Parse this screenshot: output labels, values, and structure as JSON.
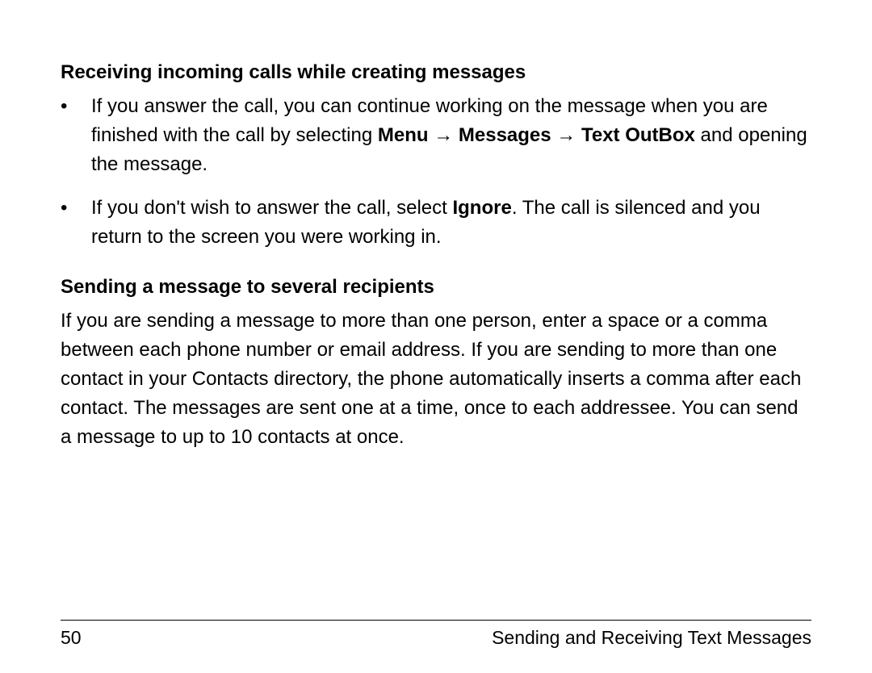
{
  "section1": {
    "heading": "Receiving incoming calls while creating messages",
    "bullet1": {
      "pre": "If you answer the call, you can continue working on the message when you are finished with the call by selecting ",
      "b1": "Menu",
      "arrow1": " → ",
      "b2": "Messages",
      "arrow2": " → ",
      "b3": "Text OutBox",
      "post": " and opening the message."
    },
    "bullet2": {
      "pre": "If you don't wish to answer the call, select ",
      "b1": "Ignore",
      "post": ". The call is silenced and you return to the screen you were working in."
    }
  },
  "section2": {
    "heading": "Sending a message to several recipients",
    "body": "If you are sending a message to more than one person, enter a space or a comma between each phone number or email address. If you are sending to more than one contact in your Contacts directory, the phone automatically inserts a comma after each contact. The messages are sent one at a time, once to each addressee. You can send a message to up to 10 contacts at once."
  },
  "footer": {
    "page_number": "50",
    "chapter": "Sending and Receiving Text Messages"
  }
}
